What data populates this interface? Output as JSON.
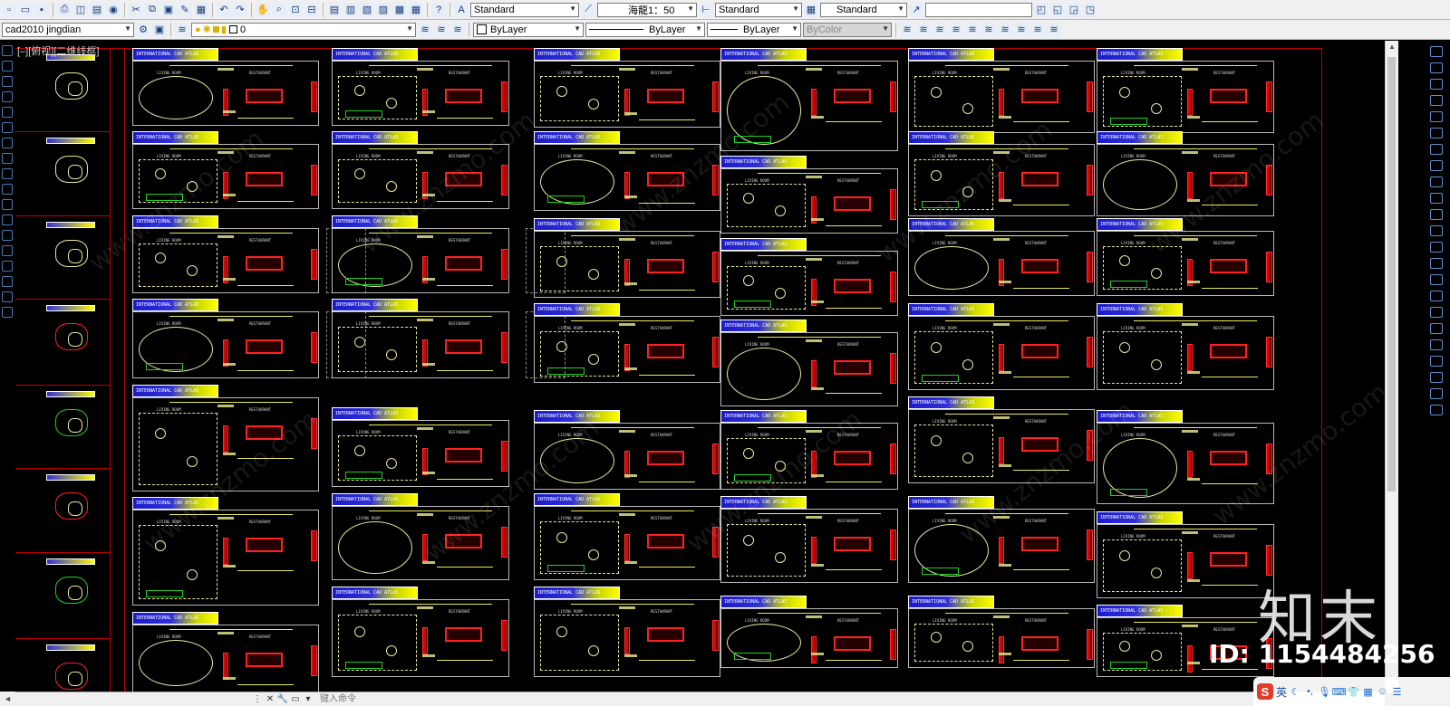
{
  "toolbar1": {
    "text_style": "Standard",
    "annotation_scale": "海龍1：50",
    "dim_style": "Standard",
    "table_style": "Standard",
    "search_value": ""
  },
  "toolbar2": {
    "workspace": "cad2010 jingdian",
    "layer": "0",
    "color": "ByLayer",
    "linetype": "ByLayer",
    "lineweight": "ByLayer",
    "plotstyle": "ByColor"
  },
  "viewport": {
    "label": "[–][俯视][二维线框]"
  },
  "sheet": {
    "banner_text": "INTERNATIONAL CAD ATLAS",
    "living_room": "LIVING ROOM",
    "restaurant": "RESTAURANT"
  },
  "command": {
    "placeholder": "键入命令"
  },
  "watermark": {
    "logo": "知末",
    "id": "ID: 1154484256",
    "diag": "www.znzmo.com"
  },
  "ime": {
    "badge": "S",
    "mode": "英"
  },
  "colors": {
    "background": "#000000",
    "banner_blue": "#1a1ac8",
    "banner_yellow": "#ffff00",
    "furniture_red": "#ff2020",
    "plan_yellow": "#e8e8a0",
    "green": "#20d020",
    "border_red": "#c00000"
  },
  "icons": [
    "new-icon",
    "open-icon",
    "save-icon",
    "print-icon",
    "undo-icon",
    "redo-icon",
    "pan-icon",
    "zoom-icon",
    "properties-icon",
    "help-icon",
    "text-style-icon",
    "dim-style-icon",
    "table-style-icon",
    "multileader-icon",
    "layer-icon",
    "layer-state-icon",
    "bulb-icon",
    "sun-icon",
    "lock-icon"
  ]
}
